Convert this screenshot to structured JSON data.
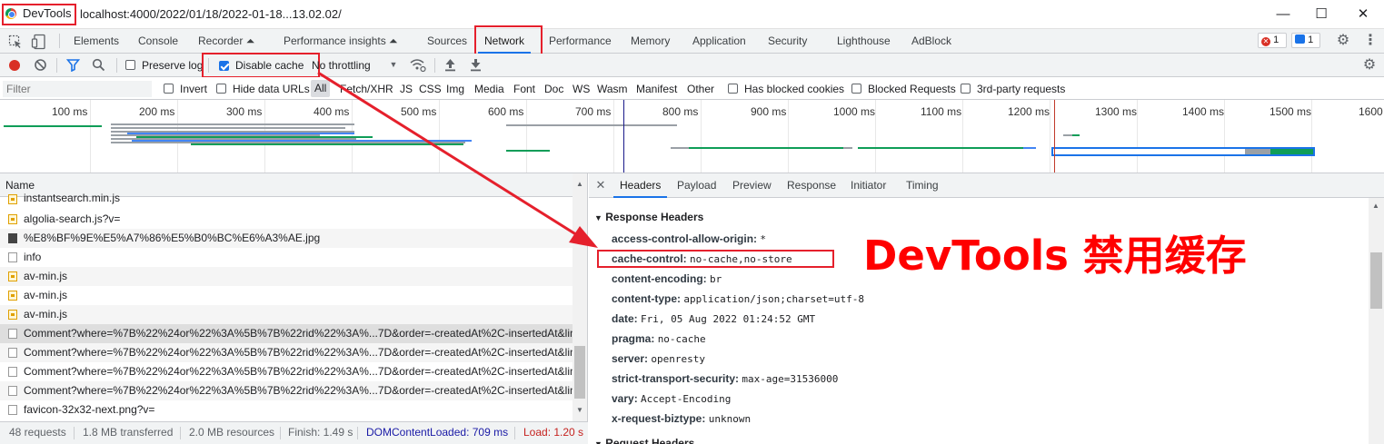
{
  "window": {
    "app_title": "DevTools",
    "url": "localhost:4000/2022/01/18/2022-01-18...13.02.02/",
    "controls": [
      "—",
      "☐",
      "✕"
    ]
  },
  "tabs": [
    {
      "label": "Elements"
    },
    {
      "label": "Console"
    },
    {
      "label": "Recorder ⏶"
    },
    {
      "label": "Performance insights ⏶"
    },
    {
      "label": "Sources"
    },
    {
      "label": "Network",
      "active": true
    },
    {
      "label": "Performance"
    },
    {
      "label": "Memory"
    },
    {
      "label": "Application"
    },
    {
      "label": "Security"
    },
    {
      "label": "Lighthouse"
    },
    {
      "label": "AdBlock"
    }
  ],
  "badges": {
    "errors": "1",
    "messages": "1"
  },
  "toolbar": {
    "preserve_log": "Preserve log",
    "disable_cache": "Disable cache",
    "throttling": "No throttling"
  },
  "filterbar": {
    "placeholder": "Filter",
    "invert": "Invert",
    "hide_data_urls": "Hide data URLs",
    "types": [
      "All",
      "Fetch/XHR",
      "JS",
      "CSS",
      "Img",
      "Media",
      "Font",
      "Doc",
      "WS",
      "Wasm",
      "Manifest",
      "Other"
    ],
    "has_blocked_cookies": "Has blocked cookies",
    "blocked_requests": "Blocked Requests",
    "third_party": "3rd-party requests"
  },
  "timeline": {
    "ticks": [
      "100 ms",
      "200 ms",
      "300 ms",
      "400 ms",
      "500 ms",
      "600 ms",
      "700 ms",
      "800 ms",
      "900 ms",
      "1000 ms",
      "1100 ms",
      "1200 ms",
      "1300 ms",
      "1400 ms",
      "1500 ms",
      "1600"
    ]
  },
  "requests": {
    "header": "Name",
    "rows": [
      {
        "name": "instantsearch.min.js",
        "type": "js"
      },
      {
        "name": "algolia-search.js?v=",
        "type": "js"
      },
      {
        "name": "%E8%BF%9E%E5%A7%86%E5%B0%BC%E6%A3%AE.jpg",
        "type": "img"
      },
      {
        "name": "info",
        "type": "doc"
      },
      {
        "name": "av-min.js",
        "type": "js"
      },
      {
        "name": "av-min.js",
        "type": "js"
      },
      {
        "name": "av-min.js",
        "type": "js"
      },
      {
        "name": "Comment?where=%7B%22%24or%22%3A%5B%7B%22rid%22%3A%...7D&order=-createdAt%2C-insertedAt&limi",
        "type": "doc"
      },
      {
        "name": "Comment?where=%7B%22%24or%22%3A%5B%7B%22rid%22%3A%...7D&order=-createdAt%2C-insertedAt&limi",
        "type": "doc"
      },
      {
        "name": "Comment?where=%7B%22%24or%22%3A%5B%7B%22rid%22%3A%...7D&order=-createdAt%2C-insertedAt&limi",
        "type": "doc"
      },
      {
        "name": "Comment?where=%7B%22%24or%22%3A%5B%7B%22rid%22%3A%...7D&order=-createdAt%2C-insertedAt&limi",
        "type": "doc"
      },
      {
        "name": "favicon-32x32-next.png?v=",
        "type": "doc"
      }
    ]
  },
  "status": {
    "requests": "48 requests",
    "transferred": "1.8 MB transferred",
    "resources": "2.0 MB resources",
    "finish": "Finish: 1.49 s",
    "dcl": "DOMContentLoaded: 709 ms",
    "load": "Load: 1.20 s"
  },
  "detail_tabs": [
    "Headers",
    "Payload",
    "Preview",
    "Response",
    "Initiator",
    "Timing"
  ],
  "response_headers": {
    "title": "Response Headers",
    "items": [
      {
        "name": "access-control-allow-origin:",
        "value": "*"
      },
      {
        "name": "cache-control:",
        "value": "no-cache,no-store"
      },
      {
        "name": "content-encoding:",
        "value": "br"
      },
      {
        "name": "content-type:",
        "value": "application/json;charset=utf-8"
      },
      {
        "name": "date:",
        "value": "Fri, 05 Aug 2022 01:24:52 GMT"
      },
      {
        "name": "pragma:",
        "value": "no-cache"
      },
      {
        "name": "server:",
        "value": "openresty"
      },
      {
        "name": "strict-transport-security:",
        "value": "max-age=31536000"
      },
      {
        "name": "vary:",
        "value": "Accept-Encoding"
      },
      {
        "name": "x-request-biztype:",
        "value": "unknown"
      }
    ]
  },
  "request_headers_title": "Request Headers",
  "annotation": "DevTools 禁用缓存",
  "colors": {
    "accent": "#1a73e8",
    "annotation_red": "#ff0000",
    "box_red": "#e5202c",
    "record": "#d93025"
  }
}
